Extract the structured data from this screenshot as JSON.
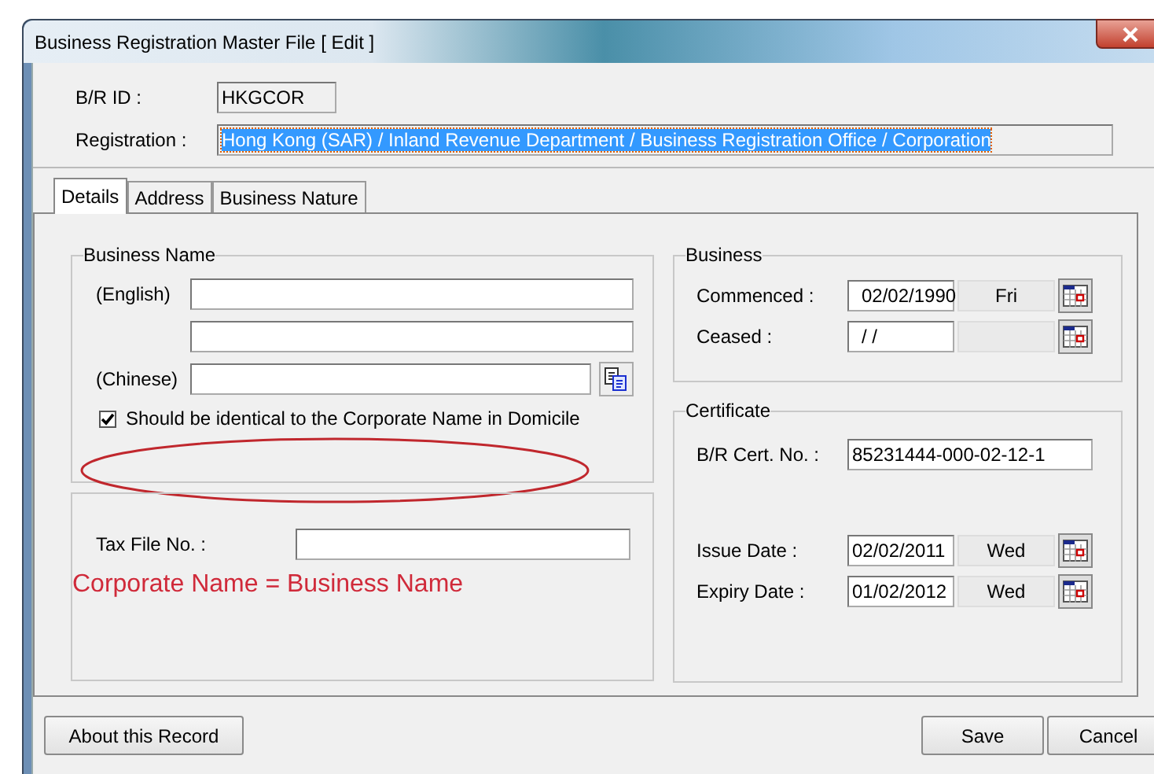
{
  "window": {
    "title": "Business Registration Master File [ Edit ]"
  },
  "header": {
    "br_id": {
      "label": "B/R ID :",
      "value": "HKGCOR"
    },
    "registration": {
      "label": "Registration :",
      "value": "Hong Kong (SAR) / Inland Revenue Department / Business Registration Office / Corporation",
      "selected": true
    }
  },
  "tabs": [
    {
      "label": "Details",
      "selected": true
    },
    {
      "label": "Address",
      "selected": false
    },
    {
      "label": "Business Nature",
      "selected": false
    }
  ],
  "business_name": {
    "title": "Business Name",
    "english_label": "(English)",
    "chinese_label": "(Chinese)",
    "identical": {
      "label": "Should be identical to the Corporate Name in Domicile",
      "checked": true
    }
  },
  "tax": {
    "label": "Tax File No. :"
  },
  "annotation": {
    "text": "Corporate Name = Business Name"
  },
  "business": {
    "title": "Business",
    "dates": [
      {
        "label": "Commenced :",
        "value": "02/02/1990",
        "day": "Fri"
      },
      {
        "label": "Ceased :",
        "value": "/ /"
      }
    ]
  },
  "certificate": {
    "title": "Certificate",
    "cert_no": {
      "label": "B/R Cert. No. :",
      "value": "85231444-000-02-12-1"
    },
    "dates": [
      {
        "label": "Issue Date :",
        "value": "02/02/2011",
        "day": "Wed"
      },
      {
        "label": "Expiry Date :",
        "value": "01/02/2012",
        "day": "Wed"
      }
    ]
  },
  "buttons": {
    "about": "About this Record",
    "save": "Save",
    "cancel": "Cancel"
  }
}
